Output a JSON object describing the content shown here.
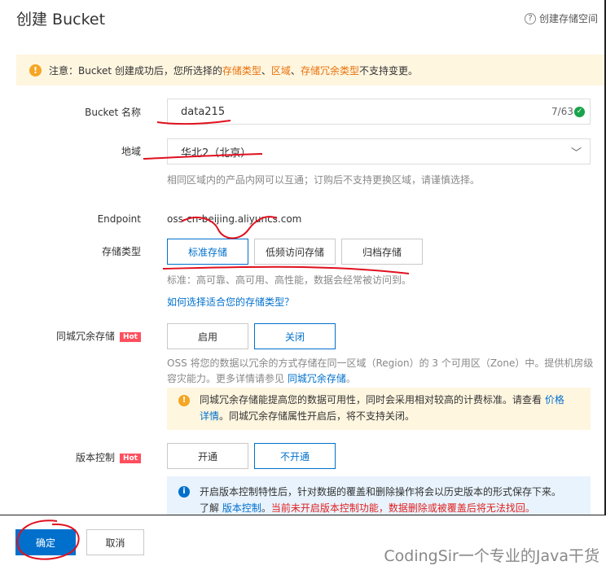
{
  "header": {
    "title": "创建 Bucket",
    "help_label": "创建存储空间",
    "help_icon": "help-circle-icon"
  },
  "notice": {
    "prefix": "注意：Bucket 创建成功后，您所选择的 ",
    "h1": "存储类型",
    "sep1": "、",
    "h2": "区域",
    "sep2": "、",
    "h3": "存储冗余类型",
    "suffix": " 不支持变更。"
  },
  "bucket_name": {
    "label": "Bucket 名称",
    "value": "data215",
    "counter": "7/63"
  },
  "region": {
    "label": "地域",
    "value": "华北2（北京）",
    "hint": "相同区域内的产品内网可以互通；订购后不支持更换区域，请谨慎选择。"
  },
  "endpoint": {
    "label": "Endpoint",
    "value": "oss-cn-beijing.aliyuncs.com"
  },
  "storage_class": {
    "label": "存储类型",
    "options": [
      "标准存储",
      "低频访问存储",
      "归档存储"
    ],
    "selected": "标准存储",
    "hint": "标准：高可靠、高可用、高性能，数据会经常被访问到。",
    "help_link": "如何选择适合您的存储类型？"
  },
  "zone_redundancy": {
    "label": "同城冗余存储",
    "badge": "Hot",
    "options": [
      "启用",
      "关闭"
    ],
    "selected": "关闭",
    "desc1": "OSS 将您的数据以冗余的方式存储在同一区域（Region）的 3 个可用区（Zone）中。提供机房级",
    "desc2": "容灾能力。更多详情请参见 ",
    "desc_link": "同城冗余存储",
    "desc_end": "。",
    "warn1": "同城冗余存储能提高您的数据可用性，同时会采用相对较高的计费标准。请查看 ",
    "warn_link1": "价格",
    "warn_link2": "详情",
    "warn2": "。同城冗余存储属性开启后，将不支持关闭。"
  },
  "versioning": {
    "label": "版本控制",
    "badge": "Hot",
    "options": [
      "开通",
      "不开通"
    ],
    "selected": "不开通",
    "info1": "开启版本控制特性后，针对数据的覆盖和删除操作将会以历史版本的形式保存下来。",
    "info2_prefix": "了解 ",
    "info2_link": "版本控制",
    "info2_mid": "。",
    "info2_red": "当前未开启版本控制功能，数据删除或被覆盖后将无法找回。"
  },
  "footer": {
    "ok": "确定",
    "cancel": "取消"
  },
  "watermark": "CodingSir一个专业的Java干货",
  "colors": {
    "primary": "#0070cc",
    "warning_bg": "#fff6e0",
    "info_bg": "#e8f3fd",
    "hot": "#ff4f5e",
    "annotation": "#e0101e"
  }
}
